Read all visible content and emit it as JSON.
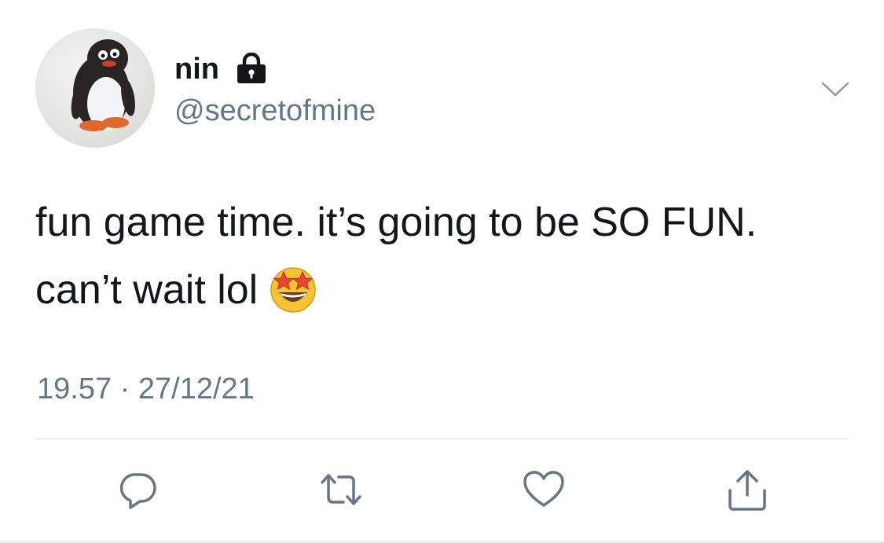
{
  "author": {
    "display_name": "nin",
    "handle": "@secretofmine",
    "avatar_icon": "penguin-avatar",
    "protected_icon": "lock-icon"
  },
  "tweet": {
    "text": "fun game time. it’s going to be SO FUN. can’t wait lol",
    "emoji": "star-struck-emoji",
    "time": "19.57",
    "separator": "·",
    "date": "27/12/21"
  },
  "actions": {
    "reply_icon": "reply-icon",
    "retweet_icon": "retweet-icon",
    "like_icon": "heart-icon",
    "share_icon": "share-icon",
    "more_icon": "chevron-down-icon"
  },
  "colors": {
    "text_primary": "#14171a",
    "text_secondary": "#657786",
    "icon_gray": "#657786",
    "divider": "#d7dde2"
  }
}
